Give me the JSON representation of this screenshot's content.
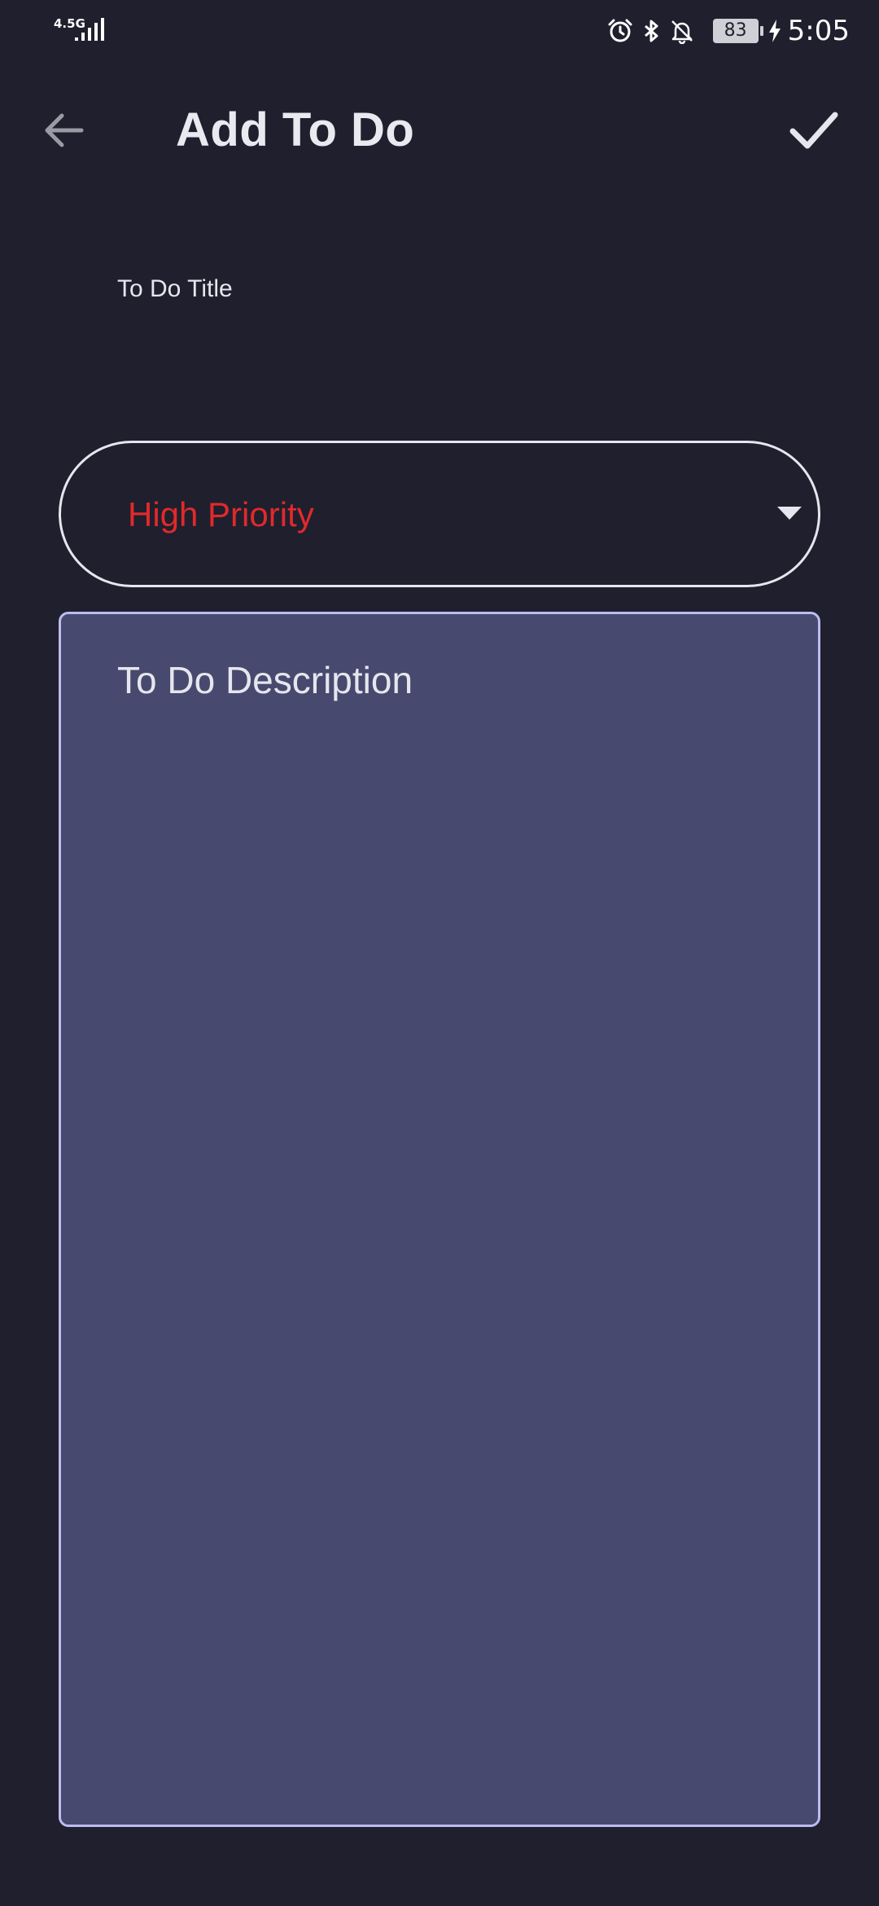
{
  "status_bar": {
    "network_type": "4.5G",
    "battery_level": "83",
    "time": "5:05",
    "icons": [
      "signal-icon",
      "alarm-icon",
      "bluetooth-icon",
      "notifications-off-icon",
      "battery-icon",
      "charging-icon"
    ]
  },
  "app_bar": {
    "title": "Add To Do",
    "back_icon": "arrow-back-icon",
    "confirm_icon": "check-icon"
  },
  "form": {
    "title_field": {
      "label": "To Do Title",
      "value": ""
    },
    "priority": {
      "selected": "High Priority",
      "selected_color": "#e02a2a"
    },
    "description": {
      "placeholder": "To Do Description",
      "value": ""
    }
  },
  "colors": {
    "background": "#1f1f2e",
    "description_fill": "#474a6e",
    "description_border": "#bdbcf0",
    "text": "#e6e6ee"
  }
}
